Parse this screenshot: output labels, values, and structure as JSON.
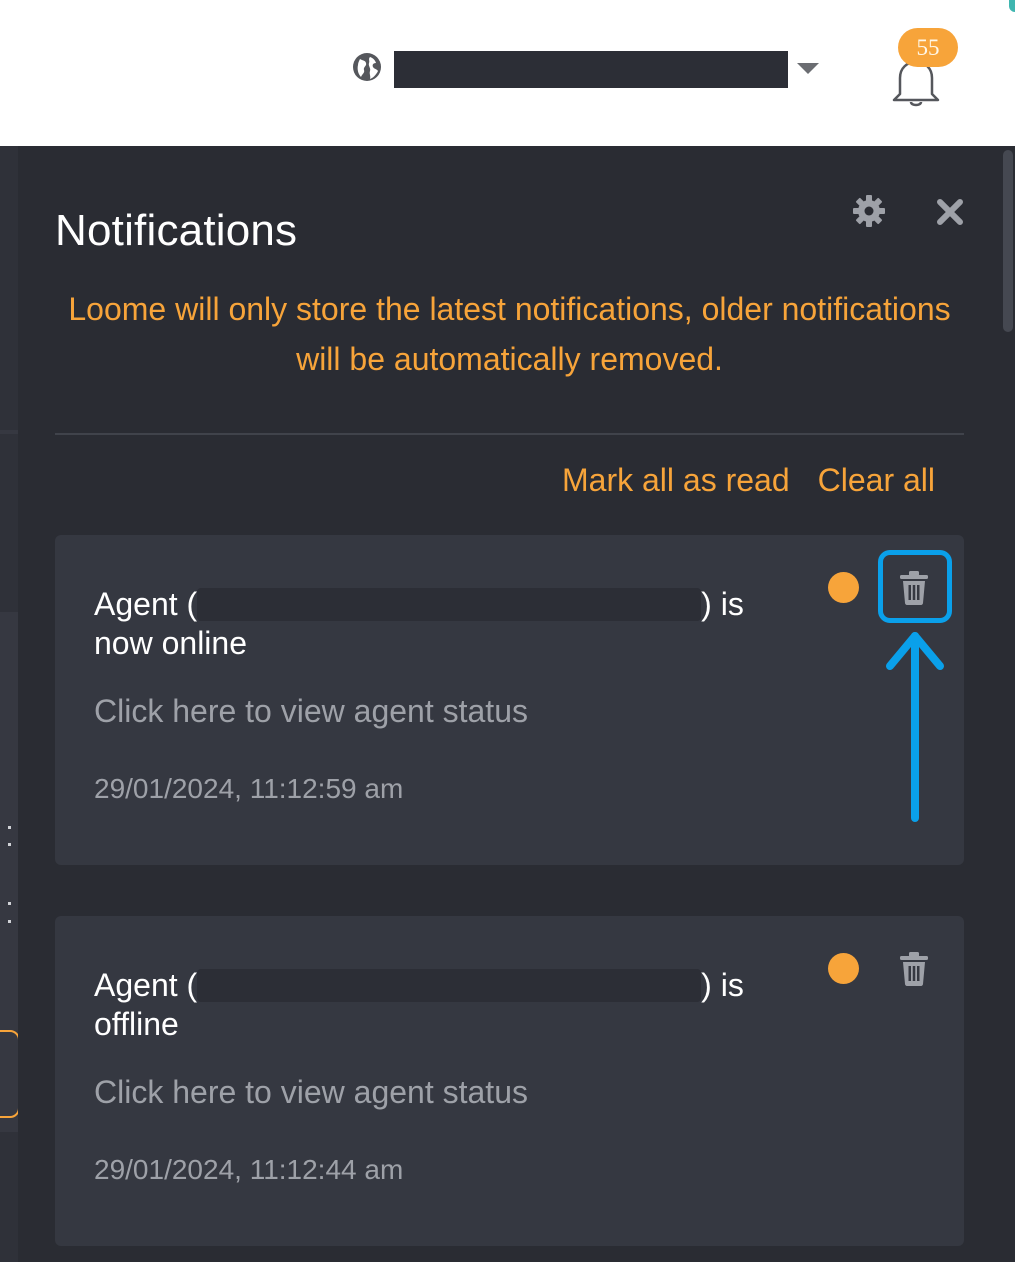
{
  "header": {
    "notification_count": "55"
  },
  "panel": {
    "title": "Notifications",
    "notice": "Loome will only store the latest notifications, older notifications will be automatically removed.",
    "mark_all_label": "Mark all as read",
    "clear_all_label": "Clear all"
  },
  "notifications": [
    {
      "title_prefix": "Agent (",
      "title_suffix": ") is now online",
      "link_text": "Click here to view agent status",
      "timestamp": "29/01/2024, 11:12:59 am",
      "unread": true
    },
    {
      "title_prefix": "Agent (",
      "title_suffix": ") is offline",
      "link_text": "Click here to view agent status",
      "timestamp": "29/01/2024, 11:12:44 am",
      "unread": true
    }
  ],
  "icons": {
    "globe": "globe-icon",
    "dropdown": "chevron-down-icon",
    "bell": "bell-icon",
    "settings": "gear-icon",
    "close": "close-icon",
    "delete": "trash-icon",
    "unread": "unread-dot-icon",
    "annotation": "arrow-up-icon"
  },
  "colors": {
    "accent": "#f7a43a",
    "panel_bg": "#2a2c33",
    "card_bg": "#353841",
    "highlight": "#0aa0ea"
  }
}
